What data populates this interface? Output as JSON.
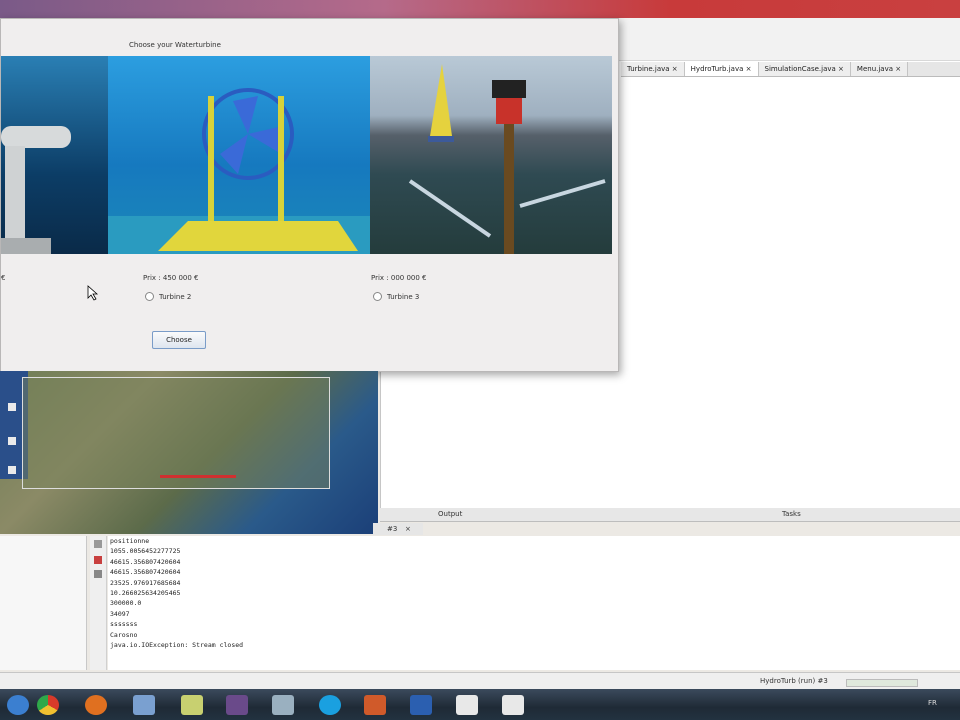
{
  "dialog": {
    "title": "Choose your Waterturbine",
    "options": [
      {
        "price": "Prix : 450 000 €",
        "label": "Turbine 2"
      },
      {
        "price": "Prix : 000 000 €",
        "label": "Turbine 3"
      }
    ],
    "choose_label": "Choose",
    "left_fragment": "€"
  },
  "ide": {
    "tabs": [
      {
        "label": "Turbine.java",
        "close": "×",
        "active": false
      },
      {
        "label": "HydroTurb.java",
        "close": "×",
        "active": true
      },
      {
        "label": "SimulationCase.java",
        "close": "×",
        "active": false
      },
      {
        "label": "Menu.java",
        "close": "×",
        "active": false
      }
    ],
    "output_label": "Output",
    "tasks_label": "Tasks",
    "output_tab": "#3",
    "output_tab_close": "×"
  },
  "console": {
    "lines": [
      "positionne",
      "1055.0056452277725",
      "46615.356807420604",
      "46615.356807420604",
      "23525.976917685684",
      "10.266025634205465",
      "300000.0",
      "34097",
      "sssssss",
      "Carosno",
      "java.io.IOException: Stream closed"
    ]
  },
  "status": {
    "process": "HydroTurb (run) #3",
    "language": "FR"
  },
  "colors": {
    "accent": "#7a9cc8",
    "taskbar": "#1f2a36"
  },
  "taskbar_icons": [
    "ie-icon",
    "chrome-icon",
    "firefox-icon",
    "virtualbox-icon",
    "notepad-icon",
    "remote-icon",
    "vmware-icon",
    "skype-icon",
    "powerpoint-icon",
    "word-icon",
    "java-icon",
    "java-icon"
  ]
}
